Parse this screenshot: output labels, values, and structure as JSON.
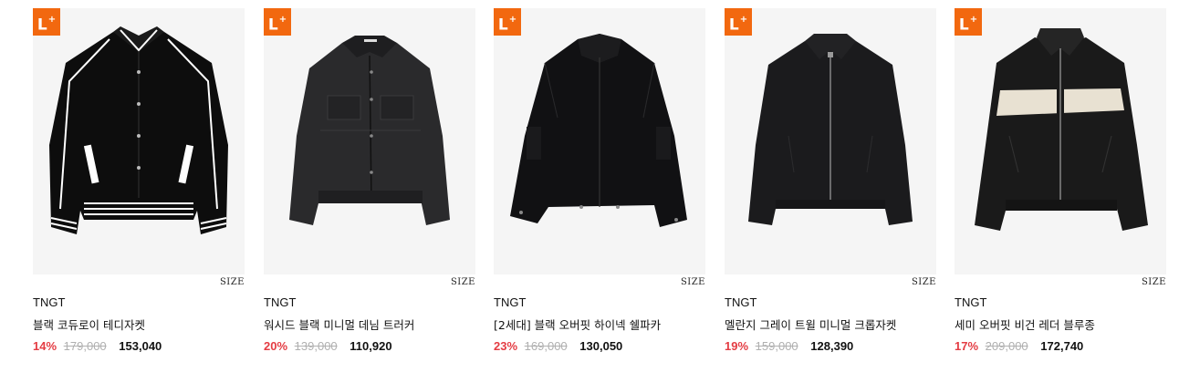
{
  "products": [
    {
      "badge": "L",
      "brand": "TNGT",
      "name": "블랙 코듀로이 테디자켓",
      "discount": "14%",
      "original_price": "179,000",
      "sale_price": "153,040",
      "size_label": "SIZE"
    },
    {
      "badge": "L",
      "brand": "TNGT",
      "name": "워시드 블랙 미니멀 데님 트러커",
      "discount": "20%",
      "original_price": "139,000",
      "sale_price": "110,920",
      "size_label": "SIZE"
    },
    {
      "badge": "L",
      "brand": "TNGT",
      "name": "[2세대] 블랙 오버핏 하이넥 쉘파카",
      "discount": "23%",
      "original_price": "169,000",
      "sale_price": "130,050",
      "size_label": "SIZE"
    },
    {
      "badge": "L",
      "brand": "TNGT",
      "name": "멜란지 그레이 트윌 미니멀 크롭자켓",
      "discount": "19%",
      "original_price": "159,000",
      "sale_price": "128,390",
      "size_label": "SIZE"
    },
    {
      "badge": "L",
      "brand": "TNGT",
      "name": "세미 오버핏 비건 레더 블루종",
      "discount": "17%",
      "original_price": "209,000",
      "sale_price": "172,740",
      "size_label": "SIZE"
    }
  ],
  "colors": {
    "badge_bg": "#f2680f",
    "discount": "#e43c43",
    "original": "#b0b0b0",
    "thumb_bg": "#f5f5f5"
  }
}
